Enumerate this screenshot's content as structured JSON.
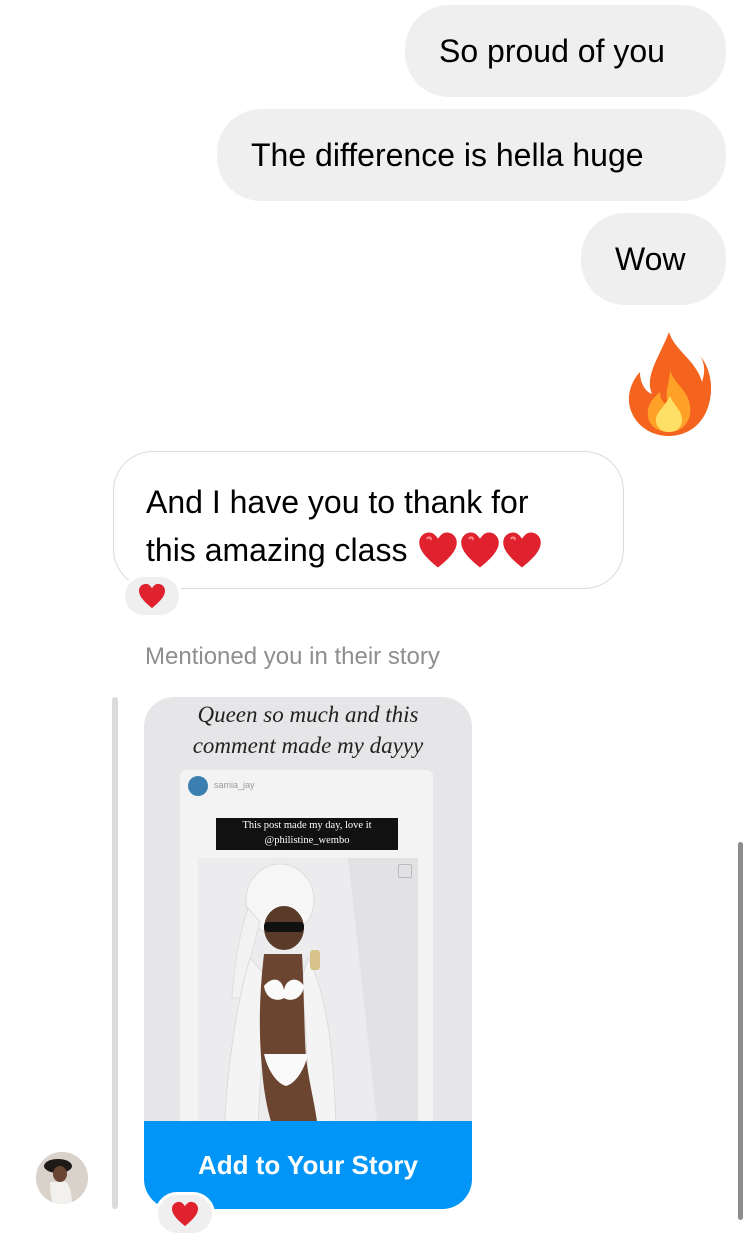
{
  "messages_outgoing": [
    {
      "text": "So proud of you"
    },
    {
      "text": "The difference is hella huge"
    },
    {
      "text": "Wow"
    }
  ],
  "outgoing_emoji": "fire-emoji",
  "incoming_message": {
    "line1": "And I have you to thank  for",
    "line2": "this amazing class",
    "reaction": "red-heart"
  },
  "story_mention": {
    "label": "Mentioned you in their story",
    "caption_line1": "Queen so much and this",
    "caption_line2": "comment made my dayyy",
    "inner_username": "samia_jay",
    "inner_comment_line1": "This post made my day, love it",
    "inner_comment_line2": "@philistine_wembo",
    "button_label": "Add to Your Story",
    "reaction": "red-heart"
  },
  "colors": {
    "outgoing_bubble": "#efefef",
    "incoming_border": "#dbdbdb",
    "accent_blue": "#0095f6",
    "heart_red": "#e0222f"
  }
}
